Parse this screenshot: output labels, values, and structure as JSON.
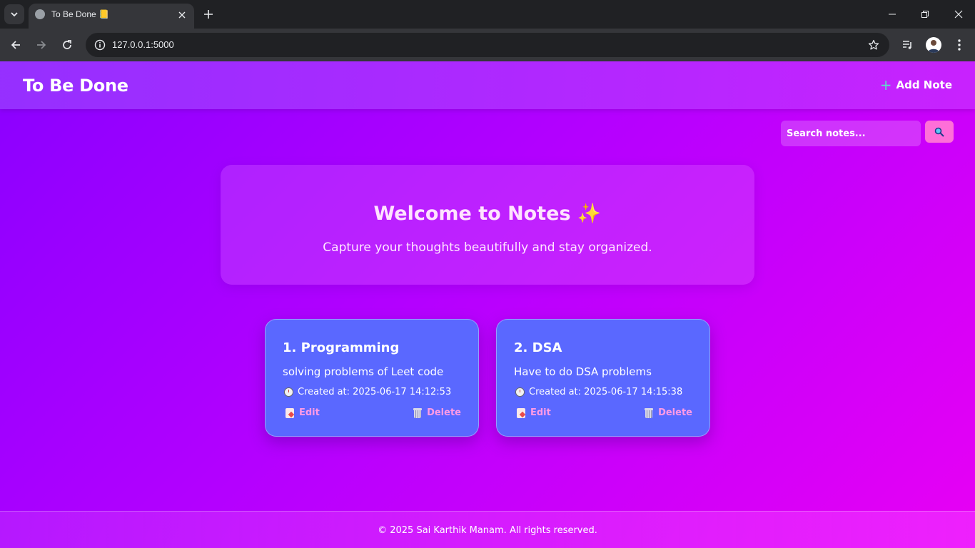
{
  "browser": {
    "tab_title": "To Be Done 📒",
    "url": "127.0.0.1:5000"
  },
  "navbar": {
    "brand": "To Be Done",
    "add_note_label": "Add Note"
  },
  "search": {
    "placeholder": "Search notes...",
    "button_icon": "magnifier-icon"
  },
  "welcome": {
    "title": "Welcome to Notes ✨",
    "subtitle": "Capture your thoughts beautifully and stay organized."
  },
  "notes": [
    {
      "title": "1. Programming",
      "body": "solving problems of Leet code",
      "created": "Created at: 2025-06-17 14:12:53",
      "edit_label": "Edit",
      "delete_label": "Delete"
    },
    {
      "title": "2. DSA",
      "body": "Have to do DSA problems",
      "created": "Created at: 2025-06-17 14:15:38",
      "edit_label": "Edit",
      "delete_label": "Delete"
    }
  ],
  "footer": {
    "text": "© 2025 Sai Karthik Manam. All rights reserved."
  },
  "colors": {
    "page_gradient_start": "#8a00ff",
    "page_gradient_end": "#e800f4",
    "note_card": "#5a68ff",
    "accent_pink": "#ff6fd8",
    "action_text": "#ff9be6"
  }
}
